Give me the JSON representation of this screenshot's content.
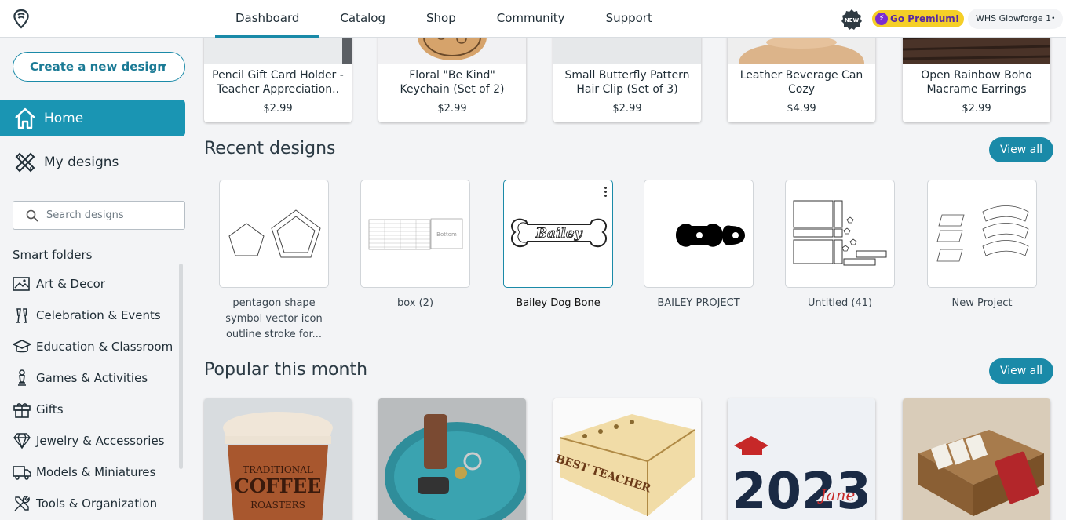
{
  "topbar": {
    "tabs": [
      "Dashboard",
      "Catalog",
      "Shop",
      "Community",
      "Support"
    ],
    "new_badge": "NEW",
    "premium_label": "Go Premium!",
    "machine_label": "WHS Glowforge 1"
  },
  "sidebar": {
    "create_label": "Create a new design",
    "home_label": "Home",
    "my_designs_label": "My designs",
    "search_placeholder": "Search designs",
    "smart_folders_title": "Smart folders",
    "folders": [
      "Art & Decor",
      "Celebration & Events",
      "Education & Classroom",
      "Games & Activities",
      "Gifts",
      "Jewelry & Accessories",
      "Models & Miniatures",
      "Tools & Organization"
    ]
  },
  "products": [
    {
      "title": "Pencil Gift Card Holder - Teacher Appreciation..",
      "price": "$2.99"
    },
    {
      "title": "Floral \"Be Kind\" Keychain (Set of 2)",
      "price": "$2.99"
    },
    {
      "title": "Small Butterfly Pattern Hair Clip (Set of 3)",
      "price": "$2.99"
    },
    {
      "title": "Leather Beverage Can Cozy",
      "price": "$4.99"
    },
    {
      "title": "Open Rainbow Boho Macrame Earrings",
      "price": "$2.99"
    }
  ],
  "recent": {
    "title": "Recent designs",
    "view_all": "View all",
    "items": [
      {
        "name": "pentagon shape symbol vector icon outline stroke for..."
      },
      {
        "name": "box (2)",
        "thumb_text": "Bottom"
      },
      {
        "name": "Bailey Dog Bone",
        "thumb_text": "Bailey"
      },
      {
        "name": "BAILEY PROJECT"
      },
      {
        "name": "Untitled (41)"
      },
      {
        "name": "New Project"
      }
    ]
  },
  "popular": {
    "title": "Popular this month",
    "view_all": "View all",
    "items": [
      {
        "img_text_1": "TRADITIONAL",
        "img_text_2": "COFFEE",
        "img_text_3": "ROASTERS"
      },
      {},
      {
        "img_text": "BEST TEACHER"
      },
      {
        "img_text": "2023",
        "img_text_2": "Jane"
      },
      {}
    ]
  },
  "colors": {
    "accent": "#1a8aa8",
    "premium": "#f5cf27"
  }
}
